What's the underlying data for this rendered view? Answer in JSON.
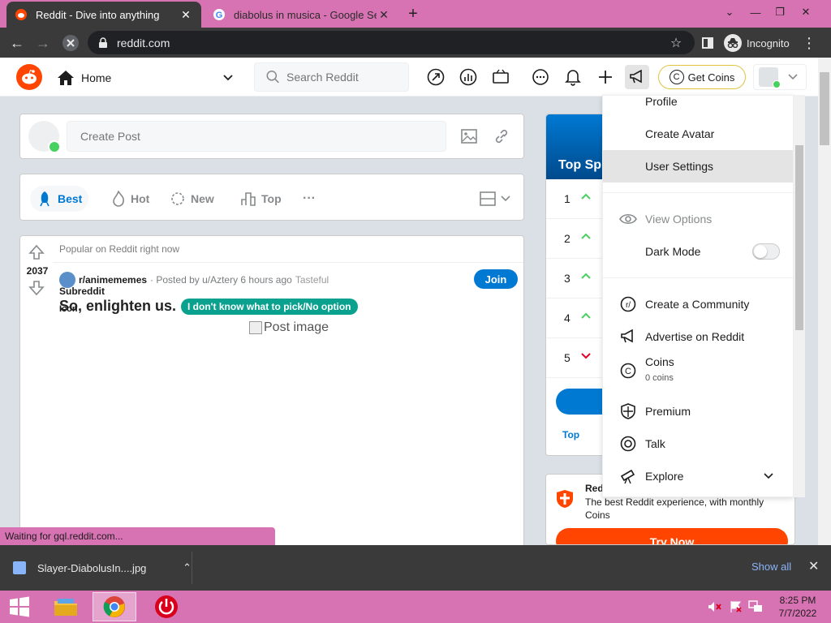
{
  "browser": {
    "tabs": [
      {
        "title": "Reddit - Dive into anything",
        "active": true
      },
      {
        "title": "diabolus in musica - Google Search",
        "active": false
      }
    ],
    "url": "reddit.com",
    "profile_label": "Incognito",
    "status_text": "Waiting for gql.reddit.com..."
  },
  "header": {
    "home_label": "Home",
    "search_placeholder": "Search Reddit",
    "get_coins_label": "Get Coins"
  },
  "create_post": {
    "placeholder": "Create Post"
  },
  "sort": {
    "items": [
      {
        "label": "Best",
        "active": true
      },
      {
        "label": "Hot"
      },
      {
        "label": "New"
      },
      {
        "label": "Top"
      }
    ],
    "more_label": "···"
  },
  "post": {
    "popular_label": "Popular on Reddit right now",
    "score": "2037",
    "subreddit": "r/animememes",
    "posted_by": "· Posted by u/Aztery 6 hours ago",
    "award_alt": "Tasteful",
    "subreddit_alt": "Subreddit",
    "icon_alt": "Icon",
    "join_label": "Join",
    "title": "So, enlighten us.",
    "flair": "I don't know what to pick/No option",
    "image_alt": "Post image"
  },
  "sidebar": {
    "top_spaces_title": "Top Sp",
    "rows": [
      {
        "rank": "1",
        "trend": "up"
      },
      {
        "rank": "2",
        "trend": "up"
      },
      {
        "rank": "3",
        "trend": "up"
      },
      {
        "rank": "4",
        "trend": "up"
      },
      {
        "rank": "5",
        "trend": "down"
      }
    ],
    "top_link": "Top",
    "premium_title": "Red",
    "premium_desc": "The best Reddit experience, with monthly Coins",
    "try_now": "Try Now"
  },
  "dropdown": {
    "profile": "Profile",
    "create_avatar": "Create Avatar",
    "user_settings": "User Settings",
    "view_options": "View Options",
    "dark_mode": "Dark Mode",
    "create_community": "Create a Community",
    "advertise": "Advertise on Reddit",
    "coins": "Coins",
    "coins_sub": "0 coins",
    "premium": "Premium",
    "talk": "Talk",
    "explore": "Explore"
  },
  "downloads": {
    "file": "Slayer-DiabolusIn....jpg",
    "show_all": "Show all"
  },
  "taskbar": {
    "time": "8:25 PM",
    "date": "7/7/2022"
  },
  "colors": {
    "reddit_orange": "#ff4500",
    "reddit_blue": "#0079d3",
    "flair_teal": "#0aa18f",
    "os_pink": "#d873b3"
  }
}
